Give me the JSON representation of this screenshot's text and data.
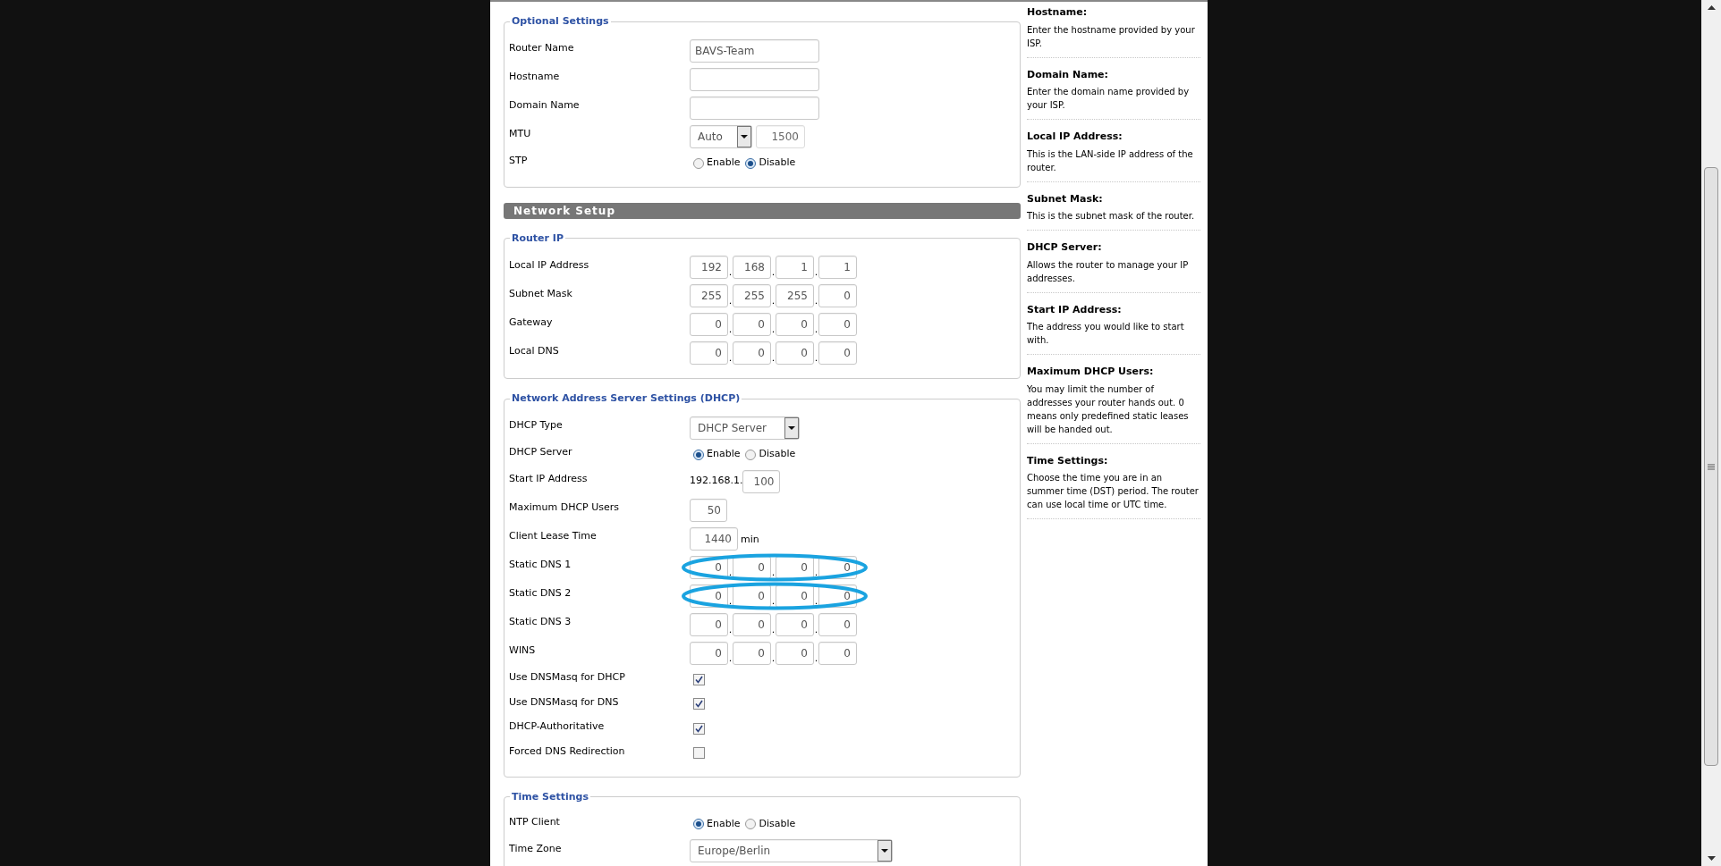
{
  "sections": [
    {
      "kind": "fieldset",
      "legend": "Optional Settings",
      "rows": [
        {
          "label": "Router Name",
          "kind": "text",
          "value": "BAVS-Team"
        },
        {
          "label": "Hostname",
          "kind": "text"
        },
        {
          "label": "Domain Name",
          "kind": "text"
        },
        {
          "label": "MTU",
          "kind": "select_number",
          "select": "Auto",
          "number": "1500",
          "number_disabled": true
        },
        {
          "label": "STP",
          "kind": "radio",
          "options": [
            {
              "label": "Enable",
              "selected": false
            },
            {
              "label": "Disable",
              "selected": true
            }
          ]
        }
      ]
    },
    {
      "kind": "heading",
      "title": "Network Setup"
    },
    {
      "kind": "fieldset",
      "legend": "Router IP",
      "rows": [
        {
          "label": "Local IP Address",
          "kind": "ip",
          "octets": [
            "192",
            "168",
            "1",
            "1"
          ],
          "separators": [
            ".",
            ".",
            "."
          ]
        },
        {
          "label": "Subnet Mask",
          "kind": "ip",
          "octets": [
            "255",
            "255",
            "255",
            "0"
          ],
          "separators": [
            ".",
            ".",
            "."
          ]
        },
        {
          "label": "Gateway",
          "kind": "ip",
          "octets": [
            "0",
            "0",
            "0",
            "0"
          ],
          "separators": [
            ".",
            ".",
            "."
          ]
        },
        {
          "label": "Local DNS",
          "kind": "ip",
          "octets": [
            "0",
            "0",
            "0",
            "0"
          ],
          "separators": [
            ".",
            ".",
            "."
          ]
        }
      ]
    },
    {
      "kind": "fieldset",
      "legend": "Network Address Server Settings (DHCP)",
      "rows": [
        {
          "label": "DHCP Type",
          "kind": "select",
          "value": "DHCP Server"
        },
        {
          "label": "DHCP Server",
          "kind": "radio",
          "options": [
            {
              "label": "Enable",
              "selected": true
            },
            {
              "label": "Disable",
              "selected": false
            }
          ]
        },
        {
          "label": "Start IP Address",
          "kind": "prefix_input",
          "prefix": "192.168.1.",
          "value": "100"
        },
        {
          "label": "Maximum DHCP Users",
          "kind": "number",
          "value": "50"
        },
        {
          "label": "Client Lease Time",
          "kind": "number",
          "value": "1440",
          "unit": "min"
        },
        {
          "label": "Static DNS 1",
          "kind": "ip",
          "octets": [
            "0",
            "0",
            "0",
            "0"
          ],
          "separators": [
            ".",
            ".",
            "."
          ],
          "highlighted": true
        },
        {
          "label": "Static DNS 2",
          "kind": "ip",
          "octets": [
            "0",
            "0",
            "0",
            "0"
          ],
          "separators": [
            ".",
            ".",
            "."
          ],
          "highlighted": true
        },
        {
          "label": "Static DNS 3",
          "kind": "ip",
          "octets": [
            "0",
            "0",
            "0",
            "0"
          ],
          "separators": [
            ".",
            ".",
            "."
          ],
          "highlighted": false
        },
        {
          "label": "WINS",
          "kind": "ip",
          "octets": [
            "0",
            "0",
            "0",
            "0"
          ],
          "separators": [
            ".",
            ".",
            "."
          ],
          "highlighted": false
        },
        {
          "label": "Use DNSMasq for DHCP",
          "kind": "checkbox",
          "checked": true
        },
        {
          "label": "Use DNSMasq for DNS",
          "kind": "checkbox",
          "checked": true
        },
        {
          "label": "DHCP-Authoritative",
          "kind": "checkbox",
          "checked": true
        },
        {
          "label": "Forced DNS Redirection",
          "kind": "checkbox",
          "checked": false
        }
      ]
    },
    {
      "kind": "fieldset",
      "legend": "Time Settings",
      "rows": [
        {
          "label": "NTP Client",
          "kind": "radio",
          "options": [
            {
              "label": "Enable",
              "selected": true
            },
            {
              "label": "Disable",
              "selected": false
            }
          ]
        },
        {
          "label": "Time Zone",
          "kind": "wide_select",
          "value": "Europe/Berlin"
        }
      ]
    }
  ],
  "help": [
    {
      "title": "Hostname:",
      "text": "Enter the hostname provided by your ISP."
    },
    {
      "title": "Domain Name:",
      "text": "Enter the domain name provided by your ISP."
    },
    {
      "title": "Local IP Address:",
      "text": "This is the LAN-side IP address of the router."
    },
    {
      "title": "Subnet Mask:",
      "text": "This is the subnet mask of the router."
    },
    {
      "title": "DHCP Server:",
      "text": "Allows the router to manage your IP addresses."
    },
    {
      "title": "Start IP Address:",
      "text": "The address you would like to start with."
    },
    {
      "title": "Maximum DHCP Users:",
      "text": "You may limit the number of addresses your router hands out. 0 means only predefined static leases will be handed out."
    },
    {
      "title": "Time Settings:",
      "text": "Choose the time you are in an summer time (DST) period. The router can use local time or UTC time."
    }
  ]
}
